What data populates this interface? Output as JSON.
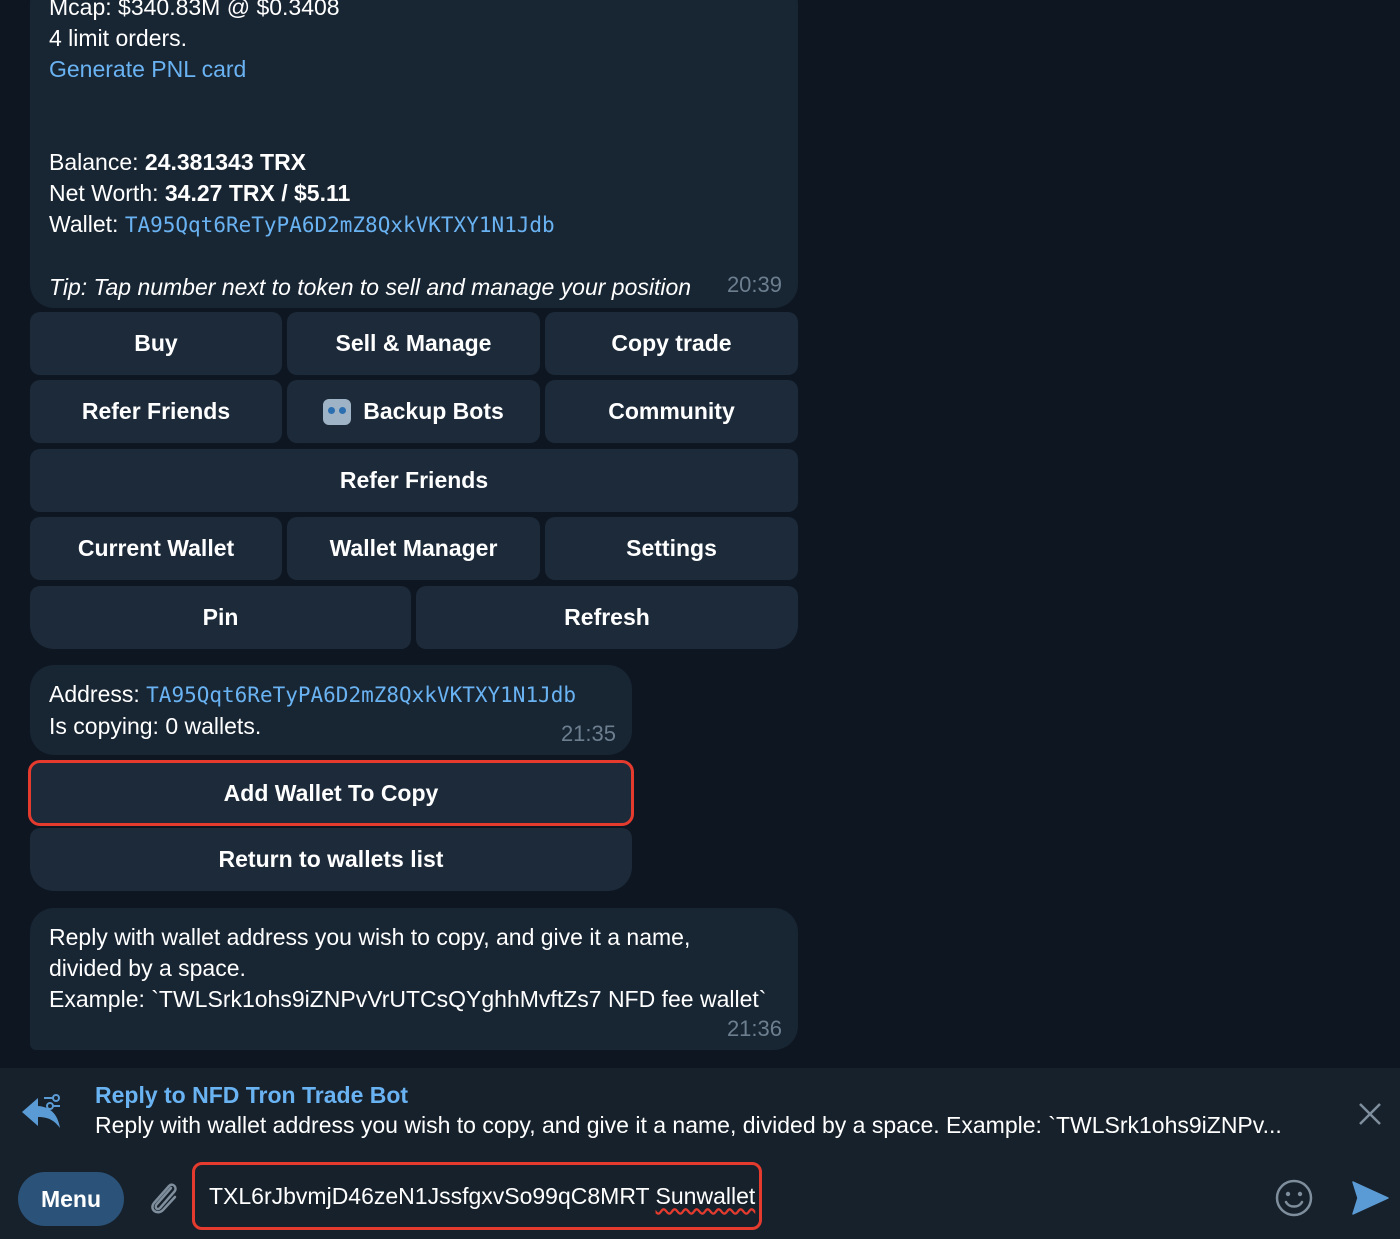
{
  "message1": {
    "mcap": "Mcap: $340.83M @ $0.3408",
    "limit_orders": "4 limit orders.",
    "pnl_link": "Generate PNL card",
    "balance_label": "Balance: ",
    "balance_value": "24.381343 TRX",
    "networth_label": "Net Worth: ",
    "networth_value": "34.27 TRX / $5.11",
    "wallet_label": "Wallet: ",
    "wallet_value": "TA95Qqt6ReTyPA6D2mZ8QxkVKTXY1N1Jdb",
    "tip": "Tip: Tap number next to token to sell and manage your position",
    "time": "20:39"
  },
  "keyboard1": {
    "buy": "Buy",
    "sell_manage": "Sell & Manage",
    "copy_trade": "Copy trade",
    "refer_friends": "Refer Friends",
    "backup_bots": "Backup Bots",
    "community": "Community",
    "refer_friends_wide": "Refer Friends",
    "current_wallet": "Current Wallet",
    "wallet_manager": "Wallet Manager",
    "settings": "Settings",
    "pin": "Pin",
    "refresh": "Refresh"
  },
  "message2": {
    "address_label": "Address: ",
    "address_value": "TA95Qqt6ReTyPA6D2mZ8QxkVKTXY1N1Jdb",
    "copying": "Is copying: 0 wallets.",
    "time": "21:35"
  },
  "keyboard2": {
    "add_wallet": "Add Wallet To Copy",
    "return_list": "Return to wallets list"
  },
  "message3": {
    "line1": "Reply with wallet address you wish to copy, and give it a name,",
    "line2": "divided by a space.",
    "line3": "Example: `TWLSrk1ohs9iZNPvVrUTCsQYghhMvftZs7 NFD fee wallet`",
    "time": "21:36"
  },
  "reply": {
    "title": "Reply to NFD Tron Trade Bot",
    "text": "Reply with wallet address you wish to copy, and give it a name, divided by a space. Example: `TWLSrk1ohs9iZNPv..."
  },
  "composer": {
    "menu_label": "Menu",
    "input_value_address": "TXL6rJbvmjD46zeN1JssfgxvSo99qC8MRT ",
    "input_value_name": "Sunwallet"
  },
  "colors": {
    "background": "#0e1621",
    "bubble": "#182533",
    "link": "#6ab3f3",
    "highlight": "#e53b2f",
    "menu_button": "#2b5278"
  }
}
